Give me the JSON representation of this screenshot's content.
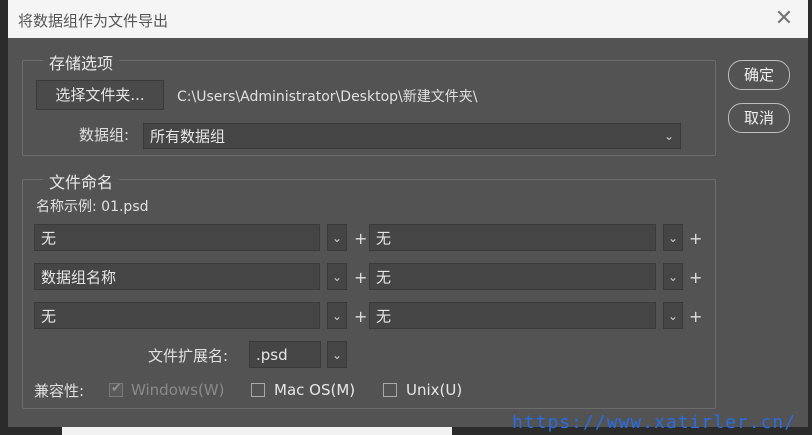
{
  "window": {
    "title": "将数据组作为文件导出"
  },
  "storage": {
    "group_title": "存储选项",
    "choose_folder_label": "选择文件夹...",
    "path": "C:\\Users\\Administrator\\Desktop\\新建文件夹\\",
    "dataset_label": "数据组:",
    "dataset_value": "所有数据组"
  },
  "buttons": {
    "ok": "确定",
    "cancel": "取消"
  },
  "naming": {
    "group_title": "文件命名",
    "example": "名称示例: 01.psd",
    "rows": [
      {
        "left": "无",
        "right": "无"
      },
      {
        "left": "数据组名称",
        "right": "无"
      },
      {
        "left": "无",
        "right": "无"
      }
    ],
    "plus": "+",
    "ext_label": "文件扩展名:",
    "ext_value": ".psd",
    "compat_label": "兼容性:",
    "compat": [
      {
        "label": "Windows(W)",
        "checked": true,
        "disabled": true
      },
      {
        "label": "Mac OS(M)",
        "checked": false,
        "disabled": false
      },
      {
        "label": "Unix(U)",
        "checked": false,
        "disabled": false
      }
    ]
  },
  "watermark": "https://www.xatirler.cn/",
  "icons": {
    "close": "close-icon",
    "dropdown": "chevron-down-icon",
    "check": "check-icon"
  }
}
